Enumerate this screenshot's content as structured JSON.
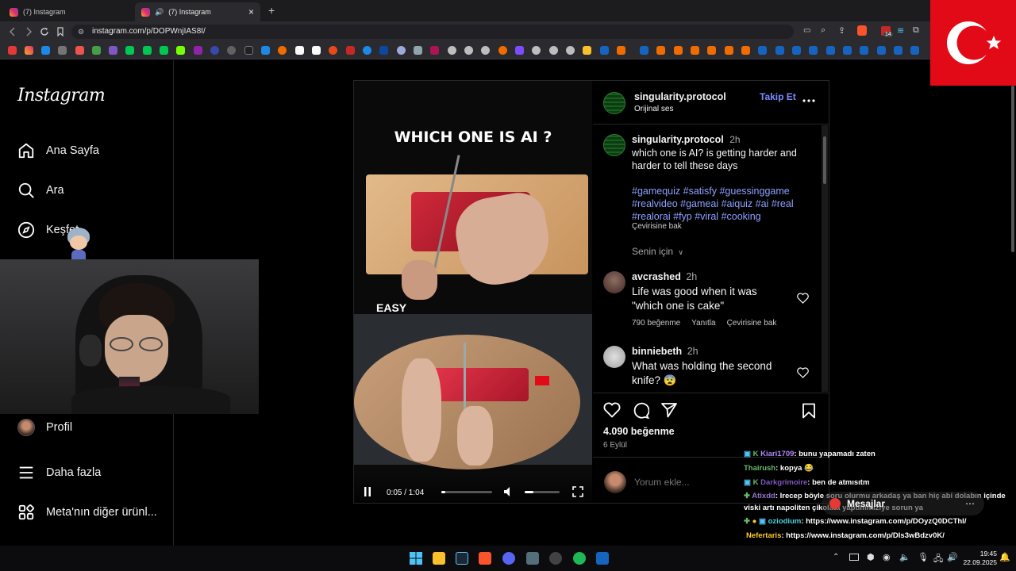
{
  "browser": {
    "tab1_title": "(7) Instagram",
    "tab2_title": "(7) Instagram",
    "new_tab": "+",
    "tab_close": "×",
    "url": "instagram.com/p/DOPWnjIAS8I/",
    "badge_count": "14"
  },
  "sidebar": {
    "logo": "Instagram",
    "items": [
      {
        "label": "Ana Sayfa",
        "icon": "home-icon"
      },
      {
        "label": "Ara",
        "icon": "search-icon"
      },
      {
        "label": "Keşfet",
        "icon": "compass-icon"
      },
      {
        "label": "Profil",
        "icon": "avatar"
      },
      {
        "label": "Daha fazla",
        "icon": "menu-icon"
      },
      {
        "label": "Meta'nın diğer ürünl...",
        "icon": "grid-icon"
      }
    ]
  },
  "video": {
    "headline": "WHICH ONE IS AI ?",
    "label_easy": "EASY",
    "time": "0:05 / 1:04",
    "progress": 0.08,
    "volume": 0.25
  },
  "post": {
    "author": "singularity.protocol",
    "audio": "Orijinal ses",
    "follow": "Takip Et",
    "more": "...",
    "caption_author": "singularity.protocol",
    "caption_time": "2h",
    "caption": "which one is AI? is getting harder and harder to tell these days",
    "hashtags": "#gamequiz #satisfy #guessinggame #realvideo #gameai #aiquiz #ai #real #realorai #fyp #viral #cooking",
    "see_translation": "Çevirisine bak",
    "for_you": "Senin için",
    "comments": [
      {
        "user": "avcrashed",
        "time": "2h",
        "text": "Life was good when it was \"which one is cake\"",
        "likes": "790 beğenme",
        "reply": "Yanıtla",
        "translate": "Çevirisine bak"
      },
      {
        "user": "binniebeth",
        "time": "2h",
        "text": "What was holding the second knife? 😨"
      }
    ],
    "likes": "4.090 beğenme",
    "date": "6 Eylül",
    "comment_placeholder": "Yorum ekle..."
  },
  "chat": {
    "messages": [
      {
        "user": "Kiari1709",
        "text": ": bunu yapamadı zaten",
        "color": "#b388ff"
      },
      {
        "user": "Thairush",
        "text": ": kopya 😂",
        "color": "#66bb6a"
      },
      {
        "user": "Darkgrimoire",
        "text": ": ben de atmısıtm",
        "color": "#7e57c2"
      },
      {
        "user": "Atixdd",
        "text": ": Irecep böyle soru olurmu arkadaş ya ban hiç abi dolabın içinde",
        "color": "#9575cd"
      },
      {
        "user": "",
        "text": "viski artı napoliten çikolata yaptımmıziye sorun ya",
        "color": "#ffffff"
      },
      {
        "user": "oziodium",
        "text": ": https://www.instagram.com/p/DOyzQ0DCThI/",
        "color": "#4dd0e1"
      },
      {
        "user": "Nefertaris",
        "text": ": https://www.instagram.com/p/DIs3wBdzv0K/",
        "color": "#ffca28"
      }
    ],
    "messages_label": "Mesajlar"
  },
  "taskbar": {
    "time": "19:45",
    "date": "22.09.2025"
  }
}
